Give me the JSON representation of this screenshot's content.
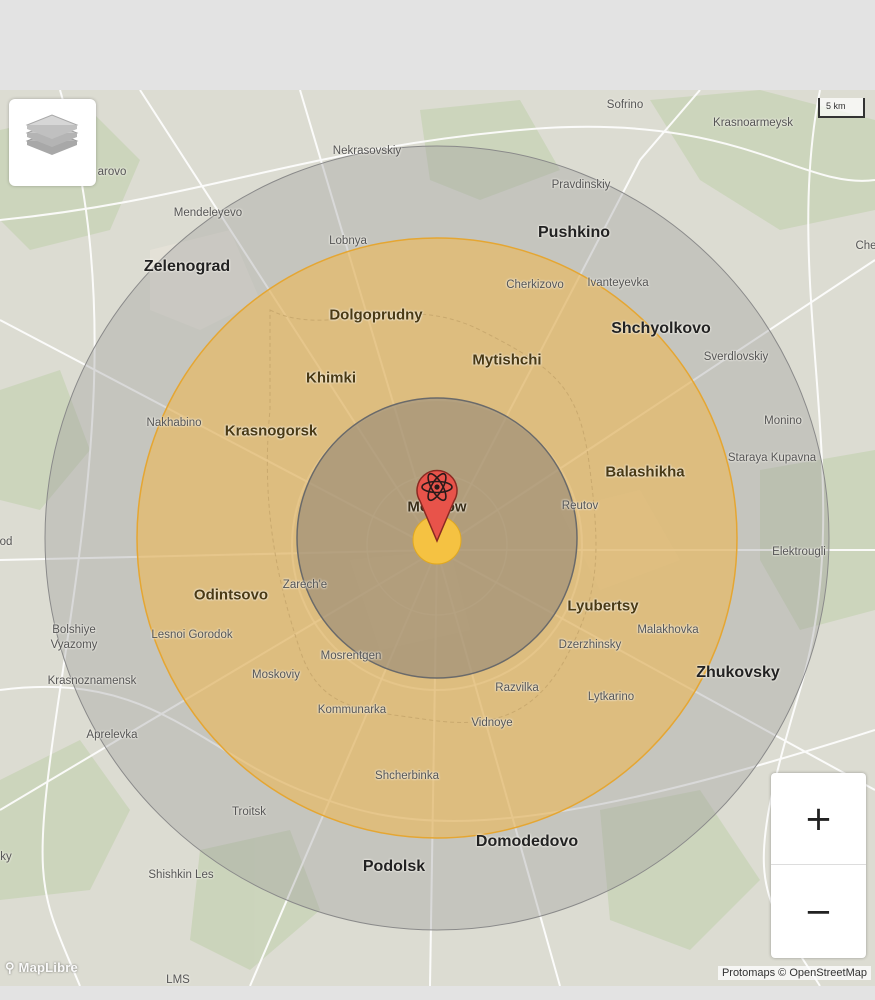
{
  "map": {
    "center_city": "Moscow",
    "colors": {
      "land": "#dcdcd2",
      "outer_ring_fill": "#9a9a9a",
      "middle_ring_fill": "#f0b64a",
      "inner_ring_fill": "#8c8478",
      "fireball_fill": "#f5c242",
      "pin_fill": "#e8534a"
    },
    "labels": {
      "sofrino": "Sofrino",
      "krasnoarmeysk": "Krasnoarmeysk",
      "nekrasovskiy": "Nekrasovskiy",
      "zarovo": "arovo",
      "pravdinskiy": "Pravdinskiy",
      "mendeleyevo": "Mendeleyevo",
      "lobnya": "Lobnya",
      "pushkino": "Pushkino",
      "che": "Che",
      "zelenograd": "Zelenograd",
      "cherkizovo": "Cherkizovo",
      "ivanteyevka": "Ivanteyevka",
      "dolgoprudny": "Dolgoprudny",
      "shchyolkovo": "Shchyolkovo",
      "mytishchi": "Mytishchi",
      "sverdlovskiy": "Sverdlovskiy",
      "khimki": "Khimki",
      "nakhabino": "Nakhabino",
      "monino": "Monino",
      "krasnogorsk": "Krasnogorsk",
      "staraya_kupavna": "Staraya Kupavna",
      "balashikha": "Balashikha",
      "moscow": "Moscow",
      "reutov": "Reutov",
      "od": "od",
      "elektrougli": "Elektrougli",
      "zarechye": "Zarech'e",
      "odintsovo": "Odintsovo",
      "lyubertsy": "Lyubertsy",
      "bolshiye_vyazomy_1": "Bolshiye",
      "bolshiye_vyazomy_2": "Vyazomy",
      "lesnoi_gorodok": "Lesnoi Gorodok",
      "malakhovka": "Malakhovka",
      "dzerzhinsky": "Dzerzhinsky",
      "mosrentgen": "Mosrentgen",
      "zhukovsky": "Zhukovsky",
      "moskoviy": "Moskoviy",
      "krasnoznamensk": "Krasnoznamensk",
      "razvilka": "Razvilka",
      "lytkarino": "Lytkarino",
      "kommunarka": "Kommunarka",
      "vidnoye": "Vidnoye",
      "aprelevka": "Aprelevka",
      "shcherbinka": "Shcherbinka",
      "troitsk": "Troitsk",
      "domodedovo": "Domodedovo",
      "ky": "ky",
      "podolsk": "Podolsk",
      "shishkin_les": "Shishkin Les",
      "lms": "LMS"
    }
  },
  "controls": {
    "layers_icon": "layers-icon",
    "scale_label": "5 km",
    "zoom_in_label": "+",
    "zoom_out_label": "−"
  },
  "footer": {
    "logo_text": "MapLibre",
    "attribution": "Protomaps © OpenStreetMap"
  }
}
